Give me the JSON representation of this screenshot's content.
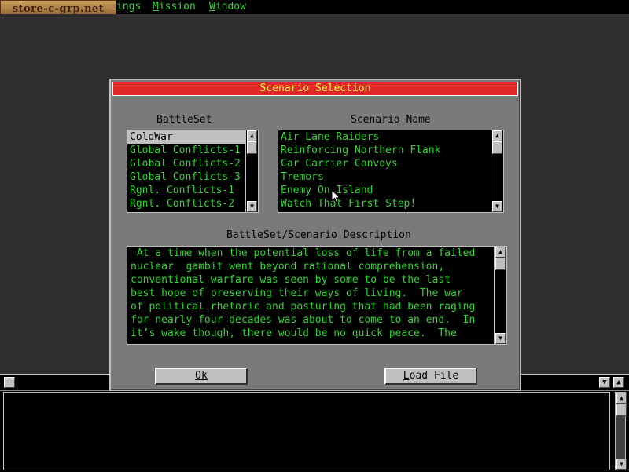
{
  "watermark": "store-c-grp.net",
  "menubar": {
    "items": [
      {
        "label": "Settings",
        "visible": "ings",
        "key": "S"
      },
      {
        "label": "Mission",
        "key": "M"
      },
      {
        "label": "Window",
        "key": "W"
      }
    ]
  },
  "dialog": {
    "title": "Scenario Selection",
    "battleset_header": "BattleSet",
    "scenario_header": "Scenario Name",
    "battlesets": [
      "ColdWar",
      "Global Conflicts-1",
      "Global Conflicts-2",
      "Global Conflicts-3",
      "Rgnl. Conflicts-1",
      "Rgnl. Conflicts-2"
    ],
    "selected_battleset": 0,
    "scenarios": [
      "Air Lane Raiders",
      "Reinforcing Northern Flank",
      "Car Carrier Convoys",
      "Tremors",
      "Enemy On Island",
      "Watch That First Step!"
    ],
    "description_header": "BattleSet/Scenario Description",
    "description_lines": [
      " At a time when the potential loss of life from a failed",
      "nuclear  gambit went beyond rational comprehension,",
      "conventional warfare was seen by some to be the last",
      "best hope of preserving their ways of living.  The war",
      "of political rhetoric and posturing that had been raging",
      "for nearly four decades was about to come to an end.  In",
      "it’s wake though, there would be no quick peace.  The"
    ],
    "ok_label": "Ok",
    "load_file_label": "Load File"
  },
  "colors": {
    "list_text": "#2fd42f",
    "title_bar": "#e02828",
    "title_text": "#ffff40",
    "dialog_bg": "#7a7a7a"
  },
  "icons": {
    "scroll_up": "triangle-up",
    "scroll_down": "triangle-down",
    "system_menu": "dash"
  }
}
